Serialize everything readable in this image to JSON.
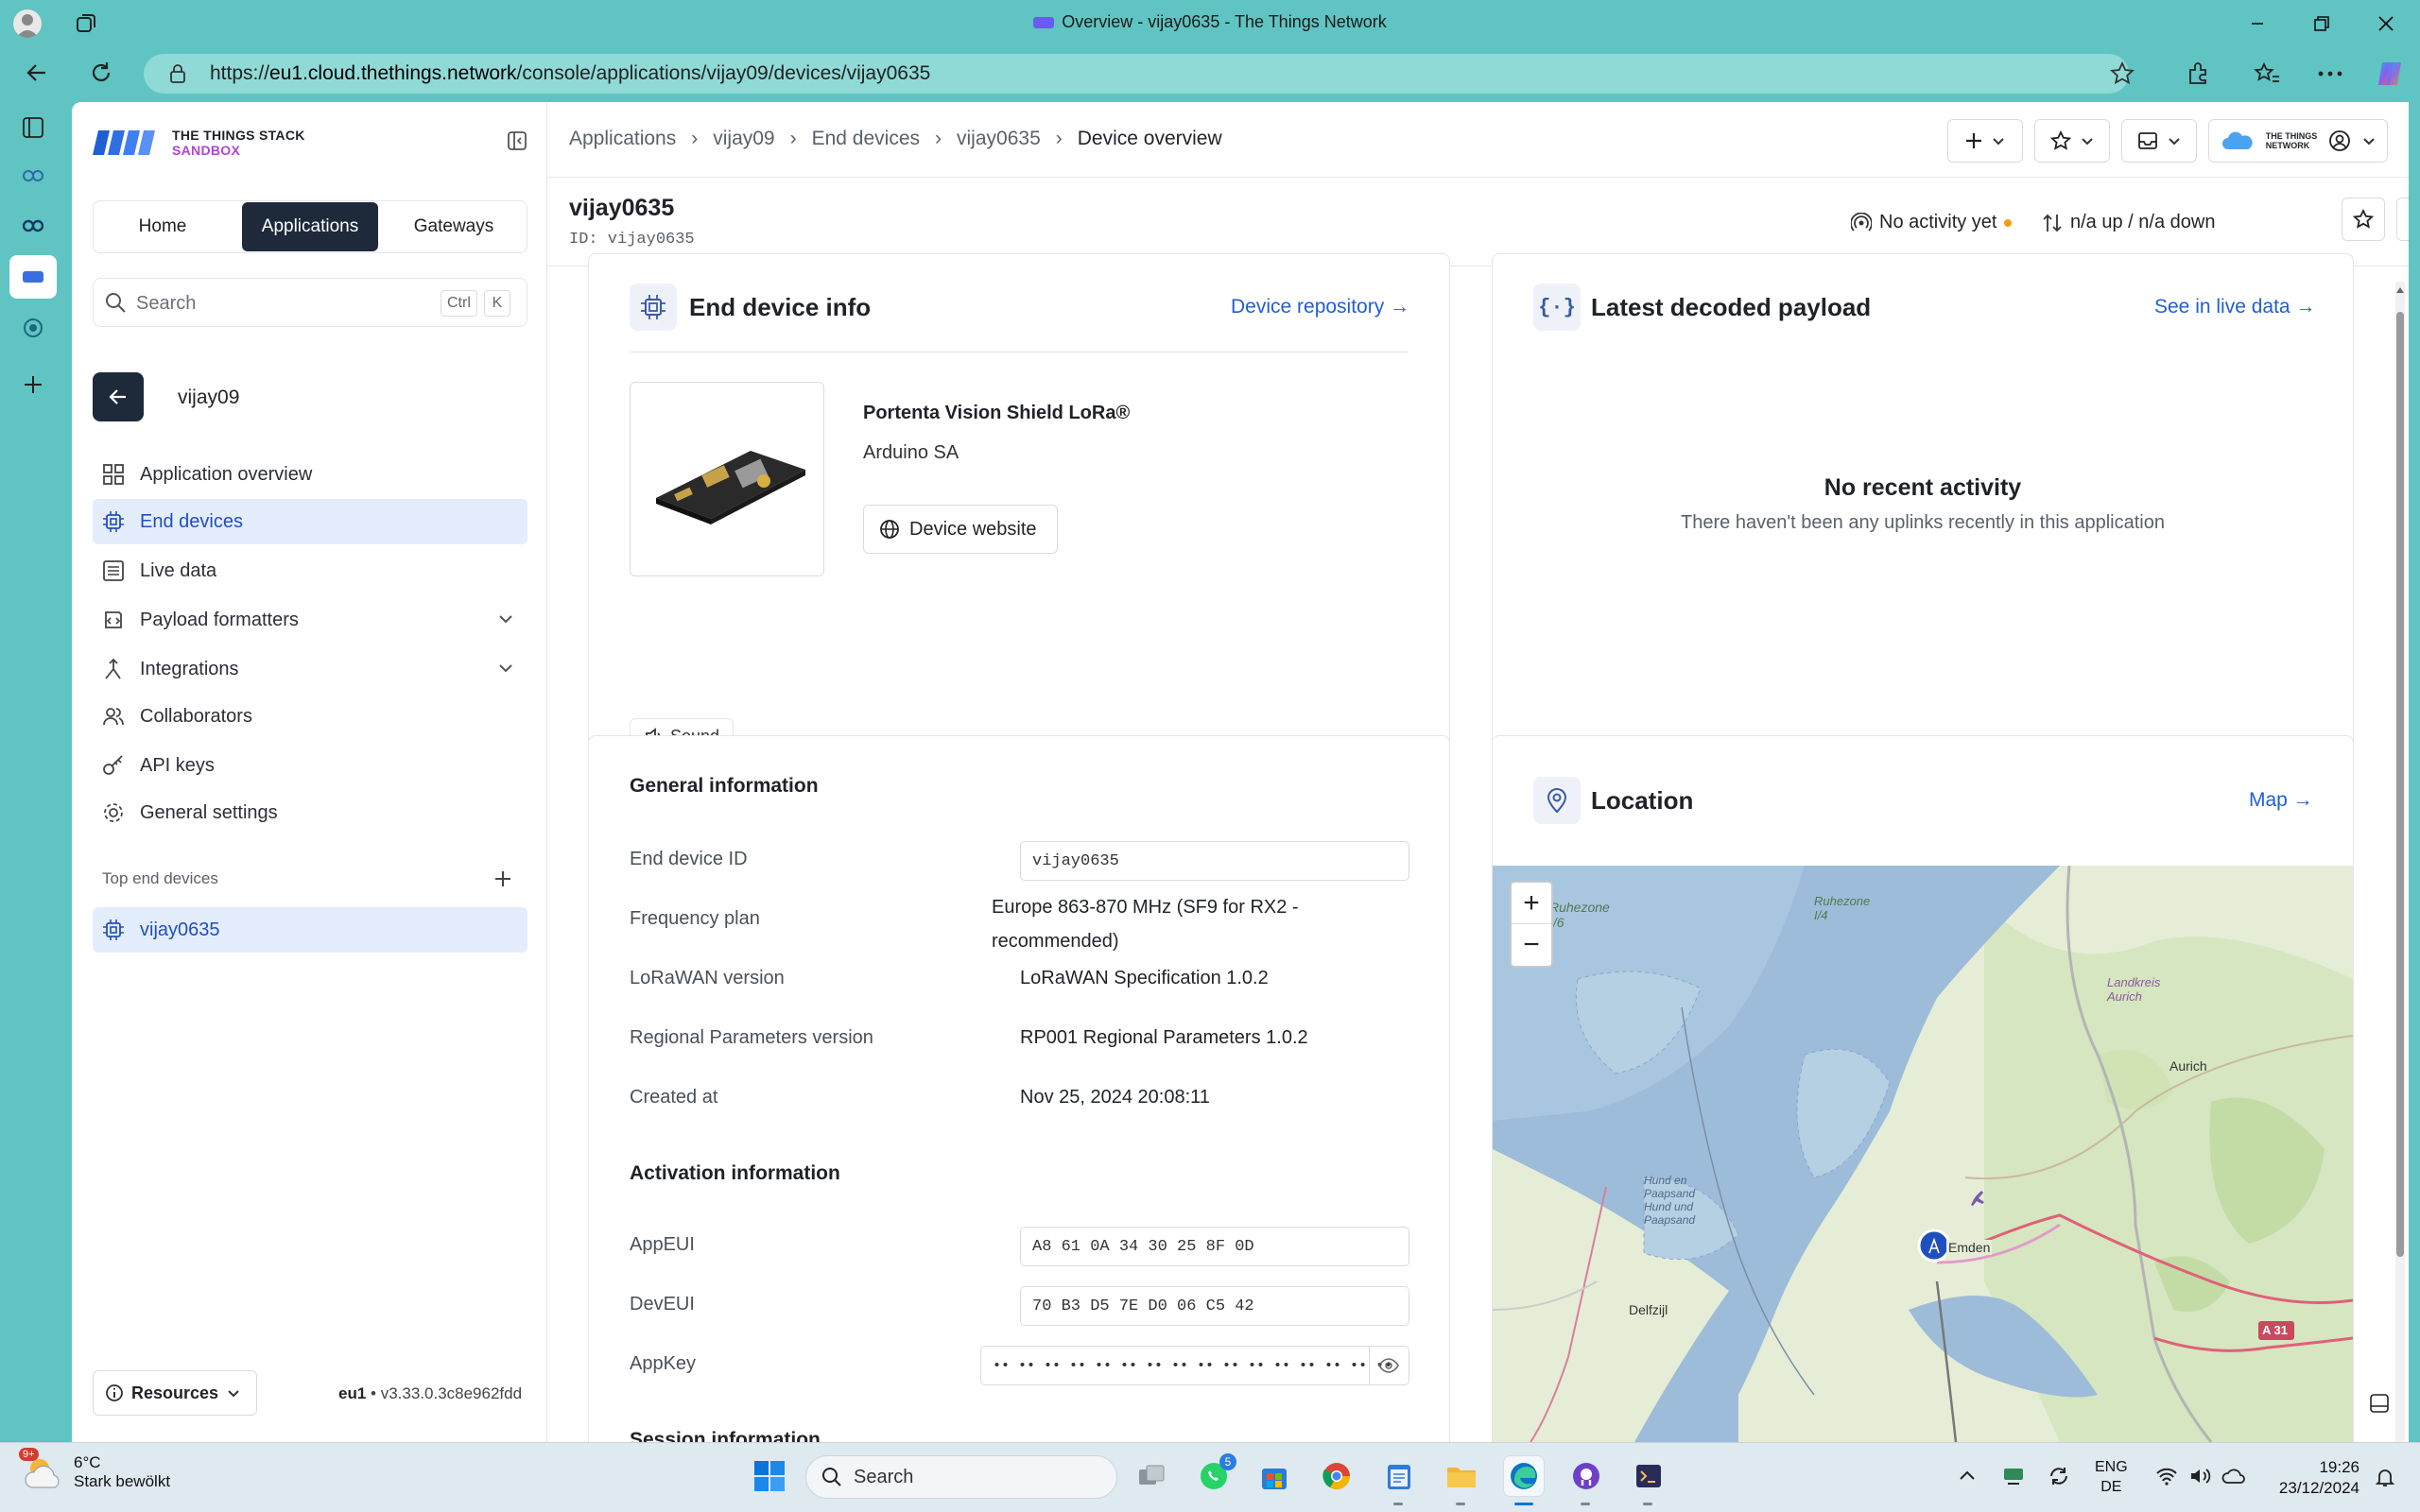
{
  "window": {
    "title": "Overview - vijay0635 - The Things Network"
  },
  "browser": {
    "url_prefix": "https://",
    "url_host": "eu1.cloud.thethings.network",
    "url_path": "/console/applications/vijay09/devices/vijay0635"
  },
  "brand": {
    "line1": "THE THINGS STACK",
    "line2": "SANDBOX"
  },
  "nav_tabs": [
    {
      "label": "Home"
    },
    {
      "label": "Applications"
    },
    {
      "label": "Gateways"
    }
  ],
  "search": {
    "placeholder": "Search",
    "key1": "Ctrl",
    "key2": "K"
  },
  "app": {
    "name": "vijay09"
  },
  "sidebar": {
    "items": [
      {
        "label": "Application overview",
        "icon": "grid-icon"
      },
      {
        "label": "End devices",
        "icon": "chip-icon"
      },
      {
        "label": "Live data",
        "icon": "list-icon"
      },
      {
        "label": "Payload formatters",
        "icon": "code-icon"
      },
      {
        "label": "Integrations",
        "icon": "integration-icon"
      },
      {
        "label": "Collaborators",
        "icon": "users-icon"
      },
      {
        "label": "API keys",
        "icon": "key-icon"
      },
      {
        "label": "General settings",
        "icon": "gear-icon"
      }
    ],
    "top_devices_label": "Top end devices",
    "top_device": "vijay0635",
    "resources_label": "Resources",
    "cluster": "eu1",
    "version": "v3.33.0.3c8e962fdd"
  },
  "breadcrumbs": [
    "Applications",
    "vijay09",
    "End devices",
    "vijay0635",
    "Device overview"
  ],
  "device": {
    "name": "vijay0635",
    "id_line": "ID: vijay0635",
    "activity": "No activity yet",
    "traffic": "n/a up / n/a down"
  },
  "info_card": {
    "title": "End device info",
    "link": "Device repository →",
    "model": "Portenta Vision Shield LoRa®",
    "vendor": "Arduino SA",
    "website_btn": "Device website",
    "tag": "Sound"
  },
  "payload_card": {
    "title": "Latest decoded payload",
    "link": "See in live data →",
    "empty_title": "No recent activity",
    "empty_text": "There haven't been any uplinks recently in this application"
  },
  "general": {
    "title": "General information",
    "rows": [
      {
        "label": "End device ID",
        "value": "vijay0635"
      },
      {
        "label": "Frequency plan",
        "value": "Europe 863-870 MHz (SF9 for RX2 -",
        "value2": "recommended)"
      },
      {
        "label": "LoRaWAN version",
        "value": "LoRaWAN Specification 1.0.2"
      },
      {
        "label": "Regional Parameters version",
        "value": "RP001 Regional Parameters 1.0.2"
      },
      {
        "label": "Created at",
        "value": "Nov 25, 2024 20:08:11"
      }
    ]
  },
  "activation": {
    "title": "Activation information",
    "rows": [
      {
        "label": "AppEUI",
        "value": "A8 61 0A 34 30 25 8F 0D"
      },
      {
        "label": "DevEUI",
        "value": "70 B3 D5 7E D0 06 C5 42"
      },
      {
        "label": "AppKey",
        "value": "•• •• •• •• •• •• •• •• •• •• •• •• •• •• •• ••"
      }
    ],
    "next_section": "Session information"
  },
  "location_card": {
    "title": "Location",
    "link": "Map →",
    "map_labels": [
      "Ruhezone I/6",
      "Ruhezone I/4",
      "Landkreis Aurich",
      "Aurich",
      "Hund en Paapsand",
      "Hund und Paapsand",
      "Delfzijl",
      "A 31",
      "Emden"
    ]
  },
  "taskbar": {
    "weather_temp": "6°C",
    "weather_desc": "Stark bewölkt",
    "weather_badge": "9+",
    "search": "Search",
    "whatsapp_badge": "5",
    "lang1": "ENG",
    "lang2": "DE",
    "time": "19:26",
    "date": "23/12/2024"
  },
  "colors": {
    "accent": "#1f5fd1",
    "dark": "#1e2a3a",
    "chrome": "#5fc4c2"
  }
}
